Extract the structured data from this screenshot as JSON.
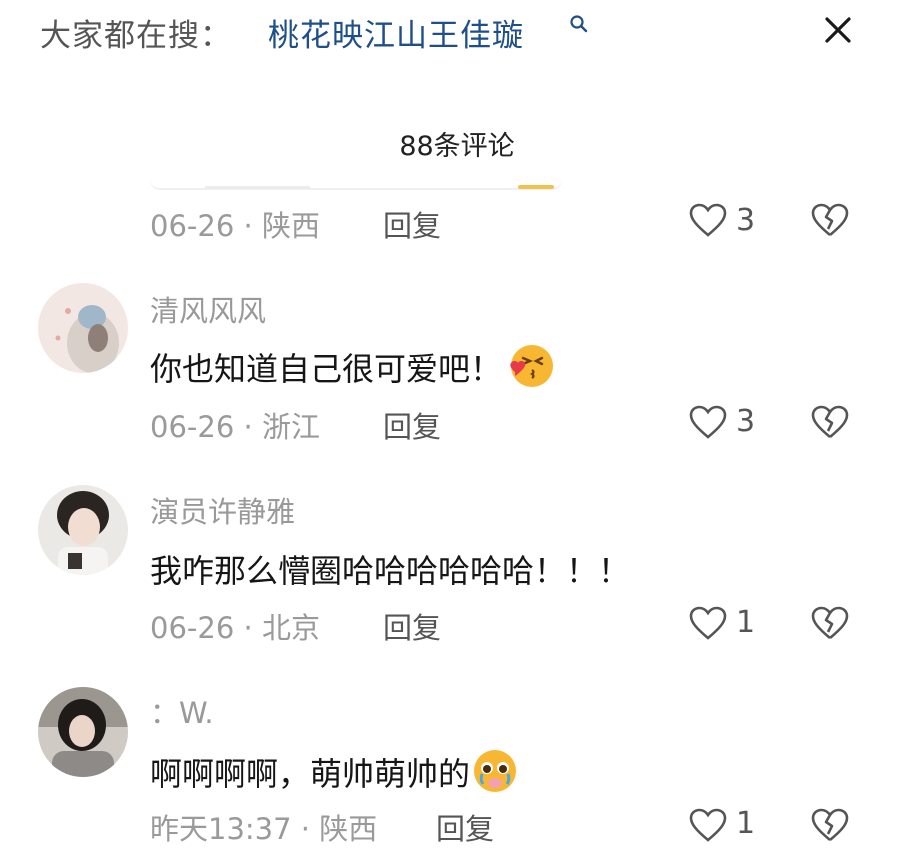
{
  "header": {
    "search_prefix": "大家都在搜：",
    "search_query": "桃花映江山王佳璇",
    "search_icon": "search-icon",
    "close_icon": "close-icon"
  },
  "comments_title": "88条评论",
  "top_meta": {
    "date": "06-26",
    "sep": "·",
    "location": "陕西",
    "reply": "回复",
    "likes": "3"
  },
  "comments": [
    {
      "username": "清风风风",
      "text": "你也知道自己很可爱吧！",
      "emoji": "blowing-kiss-emoji",
      "date": "06-26",
      "sep": "·",
      "location": "浙江",
      "reply": "回复",
      "likes": "3"
    },
    {
      "username": "演员许静雅",
      "text": "我咋那么懵圈哈哈哈哈哈哈！！！",
      "date": "06-26",
      "sep": "·",
      "location": "北京",
      "reply": "回复",
      "likes": "1"
    },
    {
      "username": "：W.",
      "text": "啊啊啊啊，萌帅萌帅的",
      "emoji": "pleading-tears-emoji",
      "date": "昨天13:37",
      "sep": "·",
      "location": "陕西",
      "reply": "回复",
      "likes": "1"
    }
  ],
  "colors": {
    "query": "#1e4f8a",
    "meta": "#9a9a9a",
    "accent": "#f2c24c"
  }
}
